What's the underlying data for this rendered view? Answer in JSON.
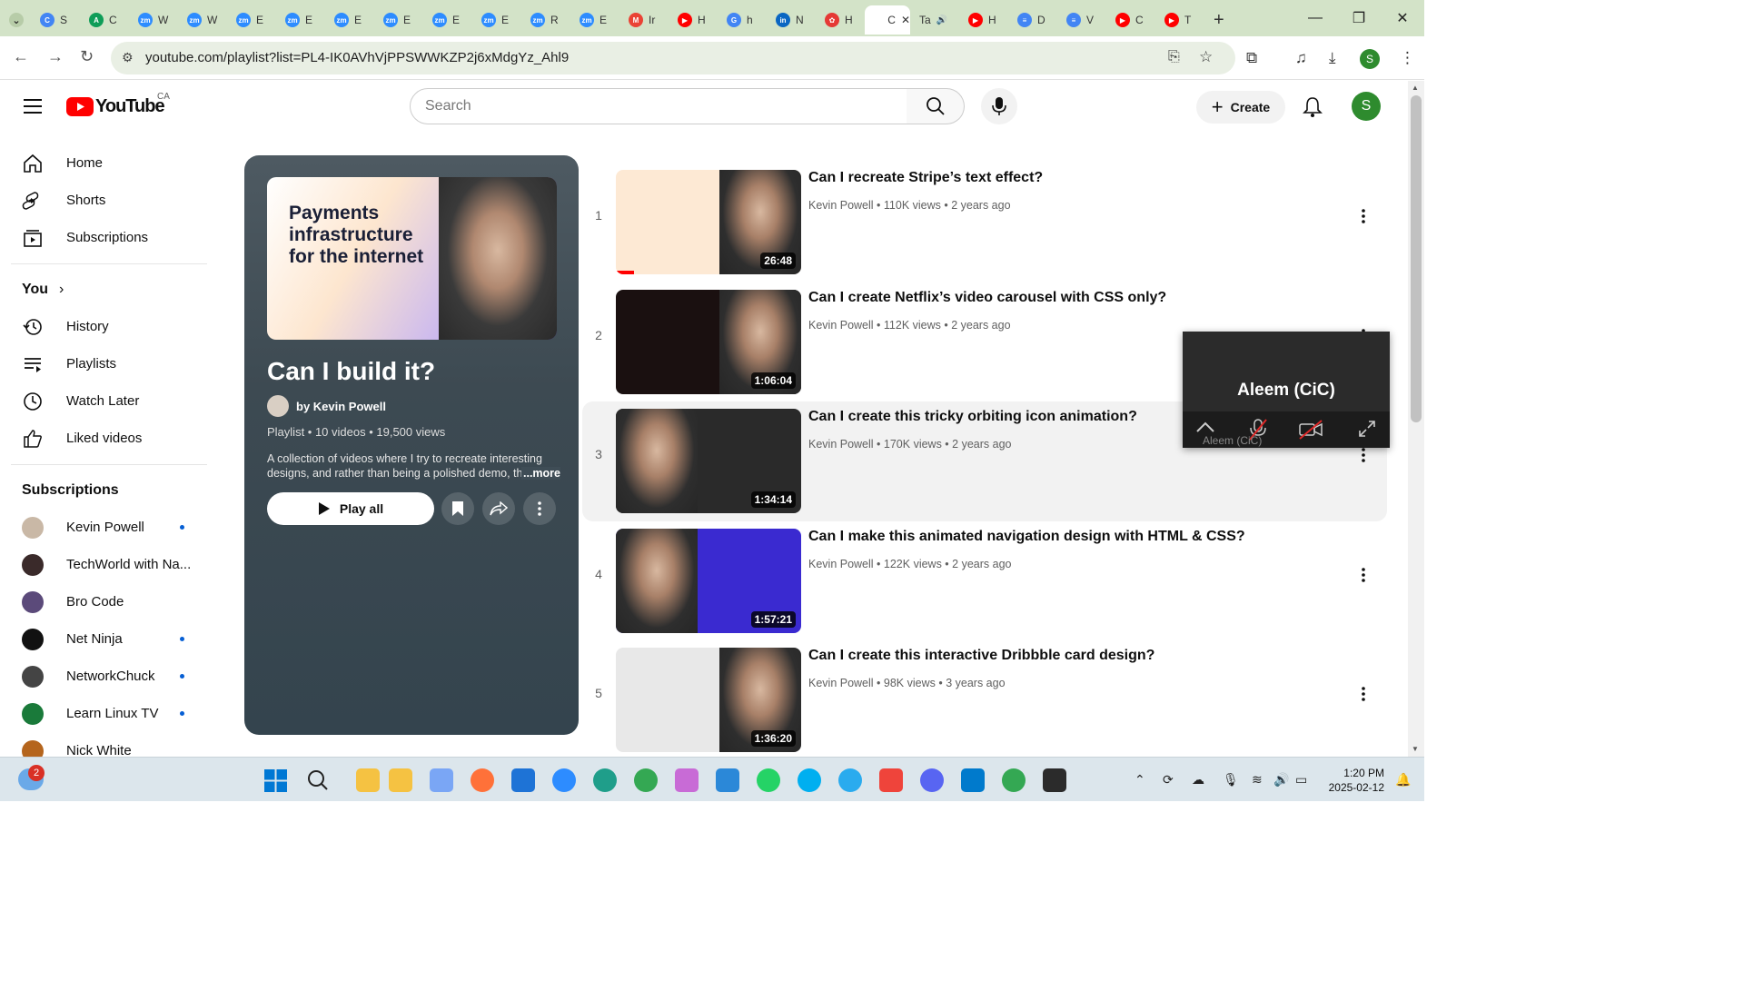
{
  "browser": {
    "tabs": [
      {
        "icon": "chrome-dropdown-icon"
      },
      {
        "label": "S",
        "color": "#4285f4",
        "letter": "C"
      },
      {
        "label": "C",
        "color": "#0f9d58",
        "letter": "A"
      },
      {
        "label": "W",
        "color": "#2d8cff",
        "letter": "zm"
      },
      {
        "label": "W",
        "color": "#2d8cff",
        "letter": "zm"
      },
      {
        "label": "E",
        "color": "#2d8cff",
        "letter": "zm"
      },
      {
        "label": "E",
        "color": "#2d8cff",
        "letter": "zm"
      },
      {
        "label": "E",
        "color": "#2d8cff",
        "letter": "zm"
      },
      {
        "label": "E",
        "color": "#2d8cff",
        "letter": "zm"
      },
      {
        "label": "E",
        "color": "#2d8cff",
        "letter": "zm"
      },
      {
        "label": "E",
        "color": "#2d8cff",
        "letter": "zm"
      },
      {
        "label": "R",
        "color": "#2d8cff",
        "letter": "zm"
      },
      {
        "label": "E",
        "color": "#2d8cff",
        "letter": "zm"
      },
      {
        "label": "Ir",
        "color": "#ea4335",
        "letter": "M"
      },
      {
        "label": "H",
        "color": "#ff0000",
        "letter": "▶"
      },
      {
        "label": "h",
        "color": "#4285f4",
        "letter": "G"
      },
      {
        "label": "N",
        "color": "#0a66c2",
        "letter": "in"
      },
      {
        "label": "H",
        "color": "#e53935",
        "letter": "✿"
      },
      {
        "label": "C",
        "active": true
      },
      {
        "label": "Ta",
        "audio": true
      },
      {
        "label": "H",
        "color": "#ff0000",
        "letter": "▶"
      },
      {
        "label": "D",
        "color": "#4285f4",
        "letter": "≡"
      },
      {
        "label": "V",
        "color": "#4285f4",
        "letter": "≡"
      },
      {
        "label": "C",
        "color": "#ff0000",
        "letter": "▶"
      },
      {
        "label": "T",
        "color": "#ff0000",
        "letter": "▶"
      }
    ],
    "new_tab": "+",
    "url": "youtube.com/playlist?list=PL4-IK0AVhVjPPSWWKZP2j6xMdgYz_Ahl9"
  },
  "youtube": {
    "logo_text": "YouTube",
    "region": "CA",
    "search_placeholder": "Search",
    "create_label": "Create",
    "avatar_letter": "S"
  },
  "sidebar": {
    "main": [
      {
        "label": "Home",
        "icon": "home-icon"
      },
      {
        "label": "Shorts",
        "icon": "shorts-icon"
      },
      {
        "label": "Subscriptions",
        "icon": "subscriptions-icon"
      }
    ],
    "you_header": "You",
    "you": [
      {
        "label": "History",
        "icon": "history-icon"
      },
      {
        "label": "Playlists",
        "icon": "playlists-icon"
      },
      {
        "label": "Watch Later",
        "icon": "watch-later-icon"
      },
      {
        "label": "Liked videos",
        "icon": "like-icon"
      }
    ],
    "subs_header": "Subscriptions",
    "subs": [
      {
        "label": "Kevin Powell",
        "color": "#c9b8a6",
        "dot": true
      },
      {
        "label": "TechWorld with Na...",
        "color": "#3a2a2a",
        "dot": false
      },
      {
        "label": "Bro Code",
        "color": "#5b4a7a",
        "dot": false
      },
      {
        "label": "Net Ninja",
        "color": "#111111",
        "dot": true
      },
      {
        "label": "NetworkChuck",
        "color": "#444444",
        "dot": true
      },
      {
        "label": "Learn Linux TV",
        "color": "#1a7a3a",
        "dot": true
      },
      {
        "label": "Nick White",
        "color": "#b5651d",
        "dot": false
      }
    ]
  },
  "playlist": {
    "thumb_headline": "Payments infrastructure for the internet",
    "title": "Can I build it?",
    "author": "by Kevin Powell",
    "meta": "Playlist • 10 videos • 19,500 views",
    "description": "A collection of videos where I try to recreate interesting designs, and rather than being a polished demo, th",
    "more": "...more",
    "play_all": "Play all"
  },
  "videos": [
    {
      "num": "1",
      "title": "Can I recreate Stripe’s text effect?",
      "channel": "Kevin Powell",
      "meta": "110K views • 2 years ago",
      "duration": "26:48",
      "bg": "#fde9d4",
      "progress": 0.1
    },
    {
      "num": "2",
      "title": "Can I create Netflix’s video carousel with CSS only?",
      "channel": "Kevin Powell",
      "meta": "112K views • 2 years ago",
      "duration": "1:06:04",
      "bg": "#1a1010"
    },
    {
      "num": "3",
      "title": "Can I create this tricky orbiting icon animation?",
      "channel": "Kevin Powell",
      "meta": "170K views • 2 years ago",
      "duration": "1:34:14",
      "bg": "#2a2a2a"
    },
    {
      "num": "4",
      "title": "Can I make this animated navigation design with HTML & CSS?",
      "channel": "Kevin Powell",
      "meta": "122K views • 2 years ago",
      "duration": "1:57:21",
      "bg": "#3a2ad0"
    },
    {
      "num": "5",
      "title": "Can I create this interactive Dribbble card design?",
      "channel": "Kevin Powell",
      "meta": "98K views • 3 years ago",
      "duration": "1:36:20",
      "bg": "#e8e8e8"
    }
  ],
  "pip": {
    "name": "Aleem (CiC)",
    "label": "Aleem (CiC)"
  },
  "taskbar": {
    "notif_count": "2",
    "time": "1:20 PM",
    "date": "2025-02-12"
  }
}
